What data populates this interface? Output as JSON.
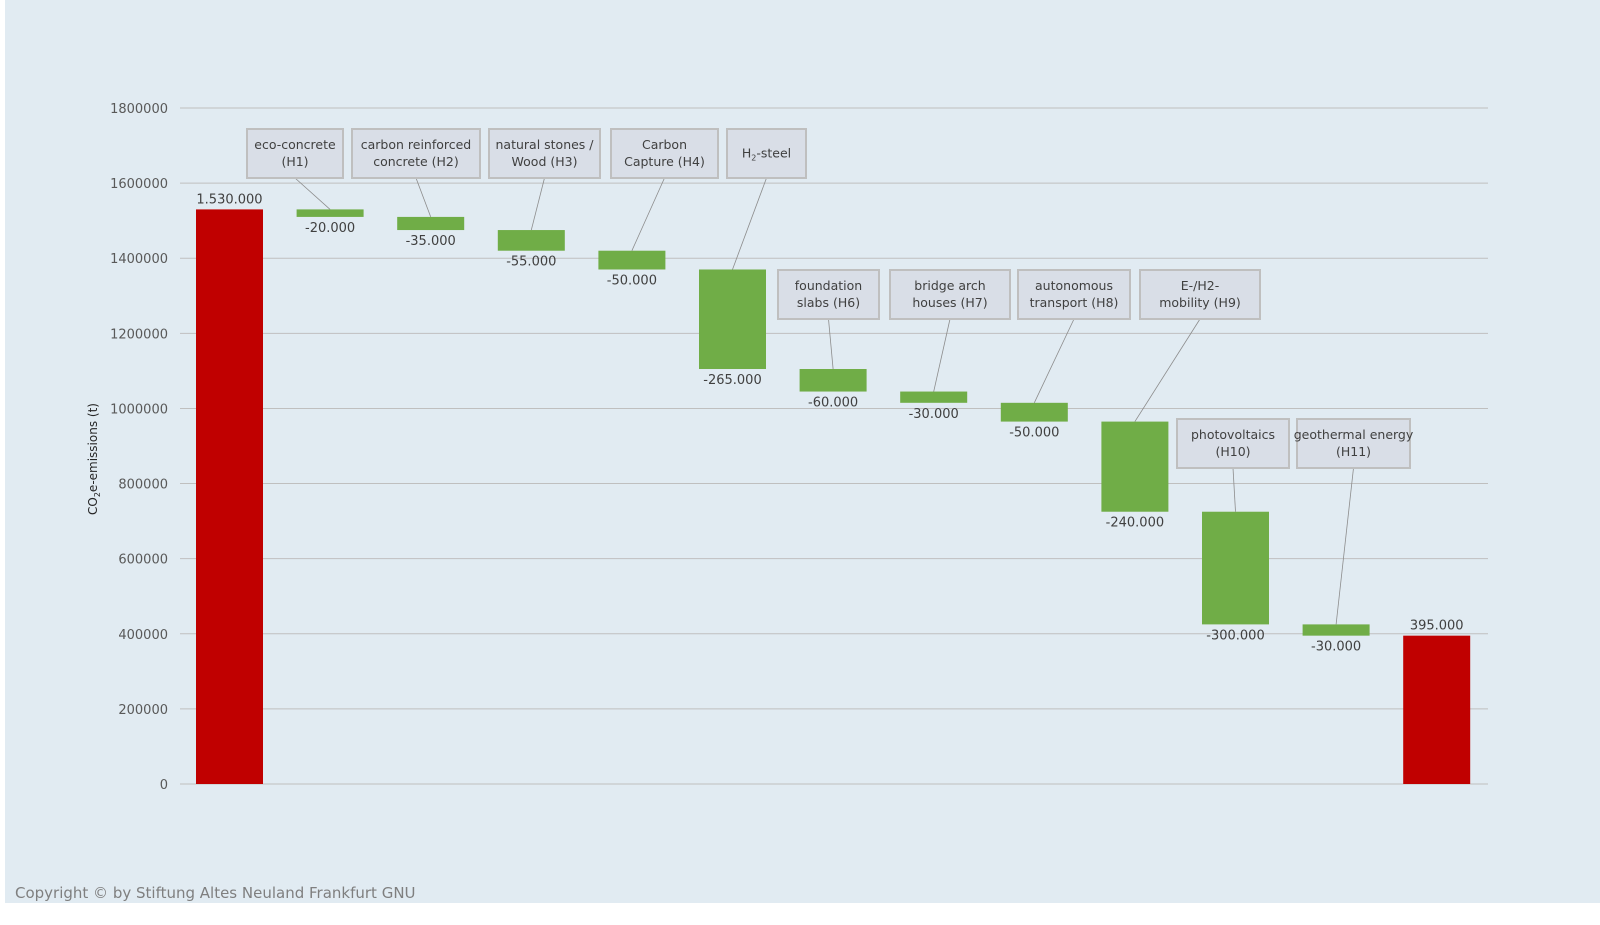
{
  "copyright": "Copyright © by Stiftung Altes Neuland Frankfurt GNU",
  "colors": {
    "background": "#e1ebf2",
    "total_bar": "#c00000",
    "decrease_bar": "#70ad47",
    "gridline": "#bfbfbf",
    "callout_fill": "#d9dee7",
    "callout_border": "#bfbfbf"
  },
  "chart_data": {
    "type": "waterfall",
    "title": "",
    "xlabel": "",
    "ylabel": "CO₂e-emissions (t)",
    "ylim": [
      0,
      1800000
    ],
    "yticks": [
      0,
      200000,
      400000,
      600000,
      800000,
      1000000,
      1200000,
      1400000,
      1600000,
      1800000
    ],
    "grid": true,
    "legend": "none",
    "steps": [
      {
        "kind": "total",
        "value": 1530000,
        "label": "1.530.000",
        "callout": []
      },
      {
        "kind": "delta",
        "value": -20000,
        "label": "-20.000",
        "callout": [
          "eco-concrete",
          "(H1)"
        ]
      },
      {
        "kind": "delta",
        "value": -35000,
        "label": "-35.000",
        "callout": [
          "carbon reinforced",
          "concrete (H2)"
        ]
      },
      {
        "kind": "delta",
        "value": -55000,
        "label": "-55.000",
        "callout": [
          "natural stones /",
          "Wood (H3)"
        ]
      },
      {
        "kind": "delta",
        "value": -50000,
        "label": "-50.000",
        "callout": [
          "Carbon",
          "Capture (H4)"
        ]
      },
      {
        "kind": "delta",
        "value": -265000,
        "label": "-265.000",
        "callout": [
          "H₂-steel"
        ]
      },
      {
        "kind": "delta",
        "value": -60000,
        "label": "-60.000",
        "callout": [
          "foundation",
          "slabs (H6)"
        ]
      },
      {
        "kind": "delta",
        "value": -30000,
        "label": "-30.000",
        "callout": [
          "bridge arch",
          "houses (H7)"
        ]
      },
      {
        "kind": "delta",
        "value": -50000,
        "label": "-50.000",
        "callout": [
          "autonomous",
          "transport (H8)"
        ]
      },
      {
        "kind": "delta",
        "value": -240000,
        "label": "-240.000",
        "callout": [
          "E-/H2-",
          "mobility (H9)"
        ]
      },
      {
        "kind": "delta",
        "value": -300000,
        "label": "-300.000",
        "callout": [
          "photovoltaics",
          "(H10)"
        ]
      },
      {
        "kind": "delta",
        "value": -30000,
        "label": "-30.000",
        "callout": [
          "geothermal energy",
          "(H11)"
        ]
      },
      {
        "kind": "total",
        "value": 395000,
        "label": "395.000",
        "callout": []
      }
    ]
  }
}
